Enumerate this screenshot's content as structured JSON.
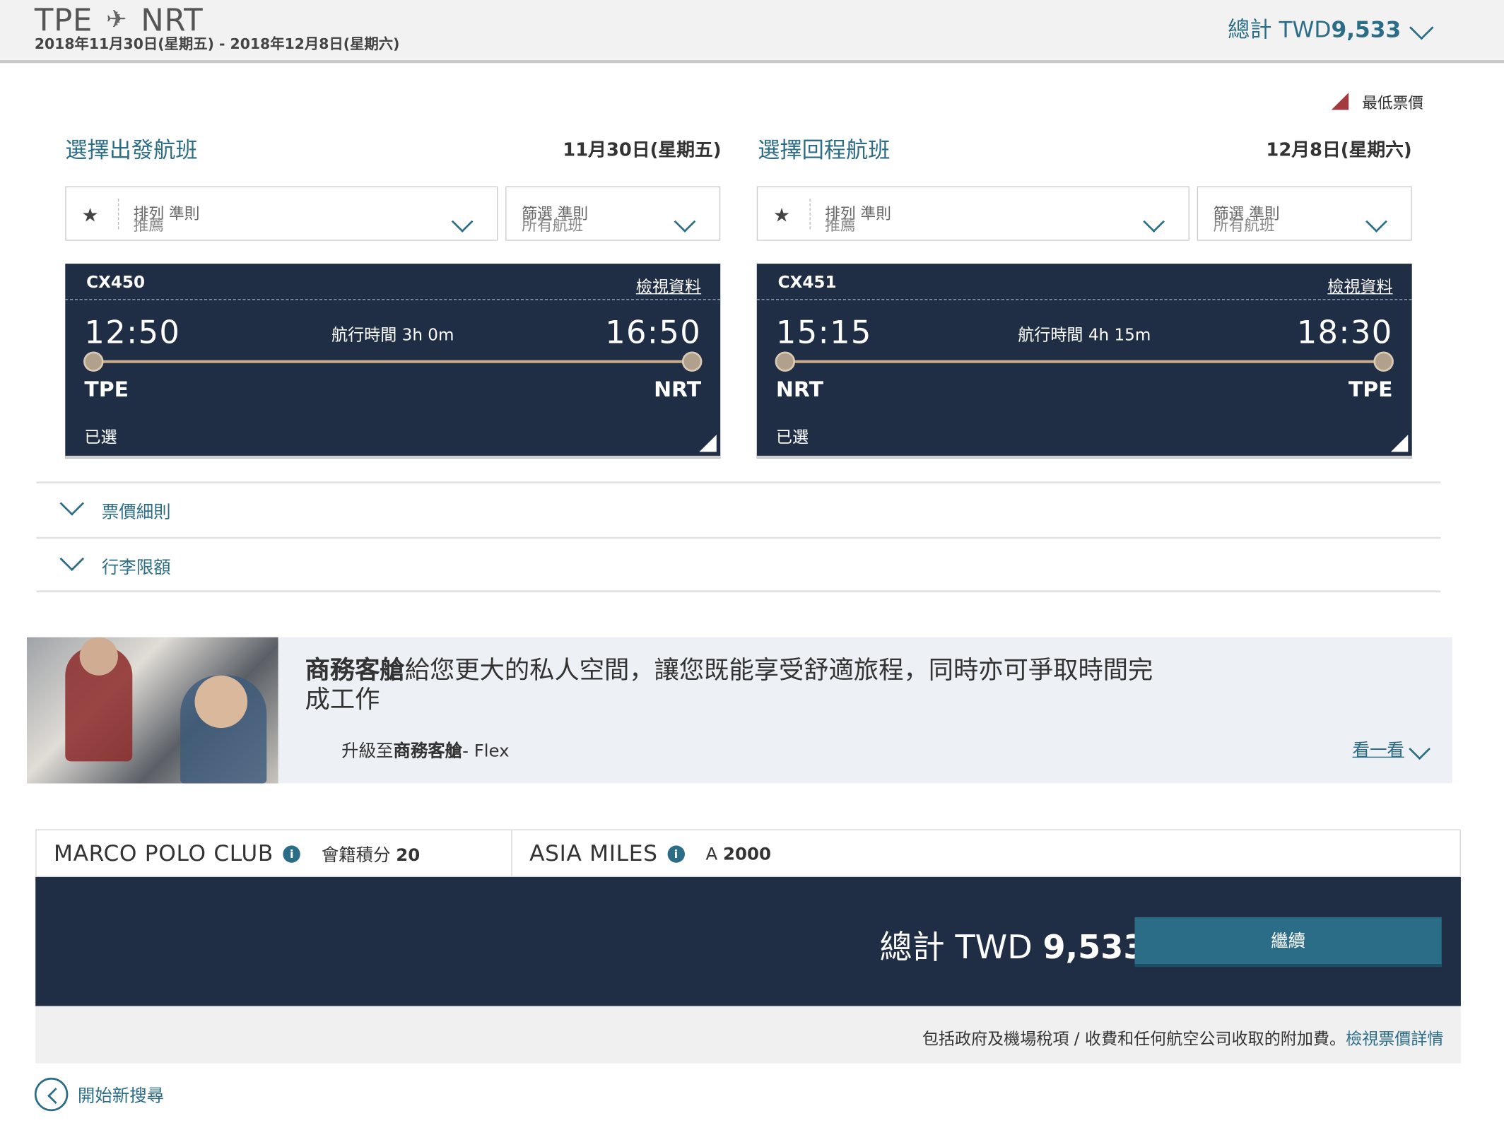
{
  "header": {
    "origin": "TPE",
    "plane_icon": "airplane-icon",
    "destination": "NRT",
    "dates": "2018年11月30日(星期五) - 2018年12月8日(星期六)",
    "total_label": "總計 TWD",
    "total_amount": "9,533"
  },
  "legend": {
    "lowest_fare": "最低票價",
    "lowest_fare_color": "#a23a3f"
  },
  "outbound": {
    "title": "選擇出發航班",
    "date": "11月30日(星期五)",
    "sort": {
      "label": "排列 準則",
      "value": "推薦"
    },
    "filter": {
      "label": "篩選 準則",
      "value": "所有航班"
    },
    "flight": {
      "number": "CX450",
      "view_details": "檢視資料",
      "depart_time": "12:50",
      "duration": "航行時間 3h 0m",
      "arrive_time": "16:50",
      "from": "TPE",
      "to": "NRT",
      "status": "已選"
    }
  },
  "inbound": {
    "title": "選擇回程航班",
    "date": "12月8日(星期六)",
    "sort": {
      "label": "排列 準則",
      "value": "推薦"
    },
    "filter": {
      "label": "篩選 準則",
      "value": "所有航班"
    },
    "flight": {
      "number": "CX451",
      "view_details": "檢視資料",
      "depart_time": "15:15",
      "duration": "航行時間 4h 15m",
      "arrive_time": "18:30",
      "from": "NRT",
      "to": "TPE",
      "status": "已選"
    }
  },
  "accordions": {
    "fare_rules": "票價細則",
    "baggage": "行李限額"
  },
  "promo": {
    "headline_bold": "商務客艙",
    "headline_rest": "給您更大的私人空間，讓您既能享受舒適旅程，同時亦可爭取時間完成工作",
    "upgrade_prefix": "升級至",
    "upgrade_bold": "商務客艙",
    "upgrade_suffix": "- Flex",
    "look_link": "看一看"
  },
  "loyalty": {
    "mpc_name": "MARCO POLO CLUB",
    "mpc_points_label": "會籍積分",
    "mpc_points": "20",
    "asia_miles_name": "ASIA MILES",
    "asia_miles_symbol": "A",
    "asia_miles_points": "2000"
  },
  "summary": {
    "total_label": "總計 TWD",
    "total_amount": "9,533",
    "continue_button": "繼續",
    "tax_note": "包括政府及機場稅項 / 收費和任何航空公司收取的附加費。",
    "fare_details_link": "檢視票價詳情"
  },
  "footer": {
    "new_search": "開始新搜尋"
  },
  "colors": {
    "brand_teal": "#2b6d87",
    "navy": "#1f2d45"
  }
}
